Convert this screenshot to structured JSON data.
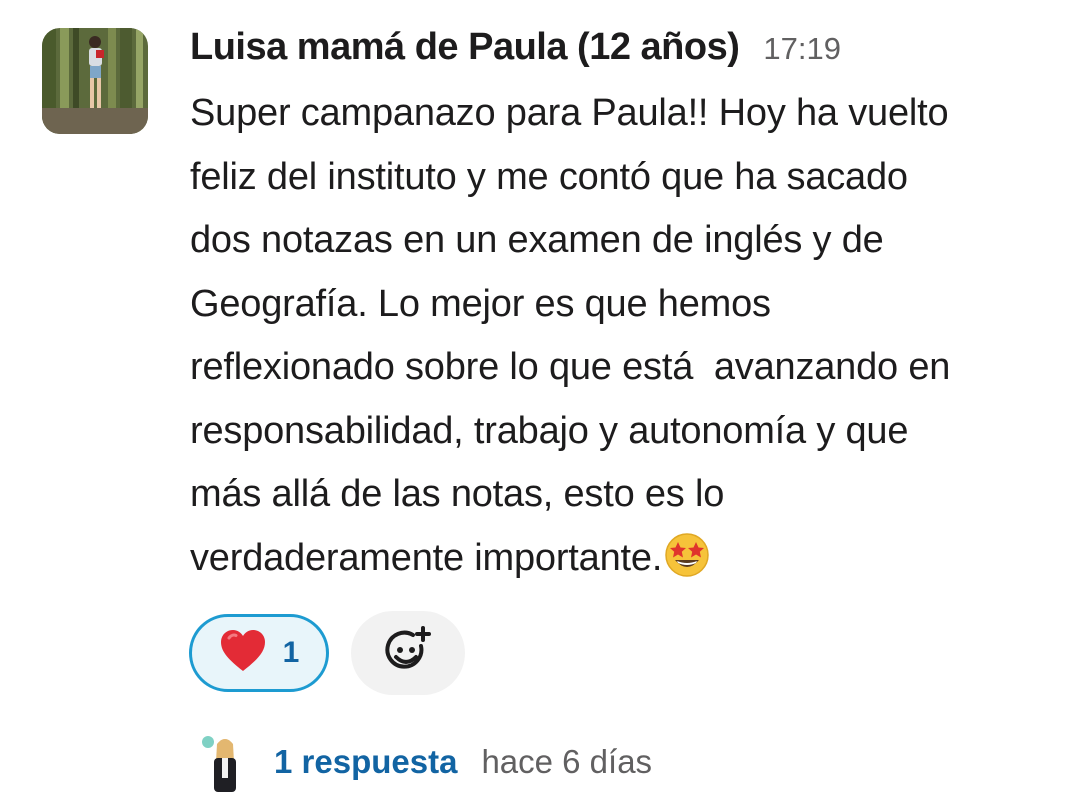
{
  "message": {
    "author": "Luisa mamá de Paula (12 años)",
    "time": "17:19",
    "lines": [
      "Super campanazo para Paula!! Hoy ha vuelto",
      "feliz del instituto y me contó que ha sacado",
      "dos notazas en un examen de inglés y de",
      "Geografía. Lo mejor es que hemos",
      "reflexionado sobre lo que está  avanzando en",
      "responsabilidad, trabajo y autonomía y que",
      "más allá de las notas, esto es lo",
      "verdaderamente importante."
    ],
    "trailing_emoji": "star-struck-emoji"
  },
  "reactions": [
    {
      "emoji": "red-heart-emoji",
      "count": "1"
    }
  ],
  "add_reaction_icon": "add-emoji-icon",
  "thread": {
    "replies": "1 respuesta",
    "last_reply": "hace 6 días"
  },
  "colors": {
    "text": "#1d1c1d",
    "muted": "#616061",
    "link": "#1264a3",
    "reaction_border": "#1d9bd1",
    "reaction_bg": "#e8f5fa"
  }
}
